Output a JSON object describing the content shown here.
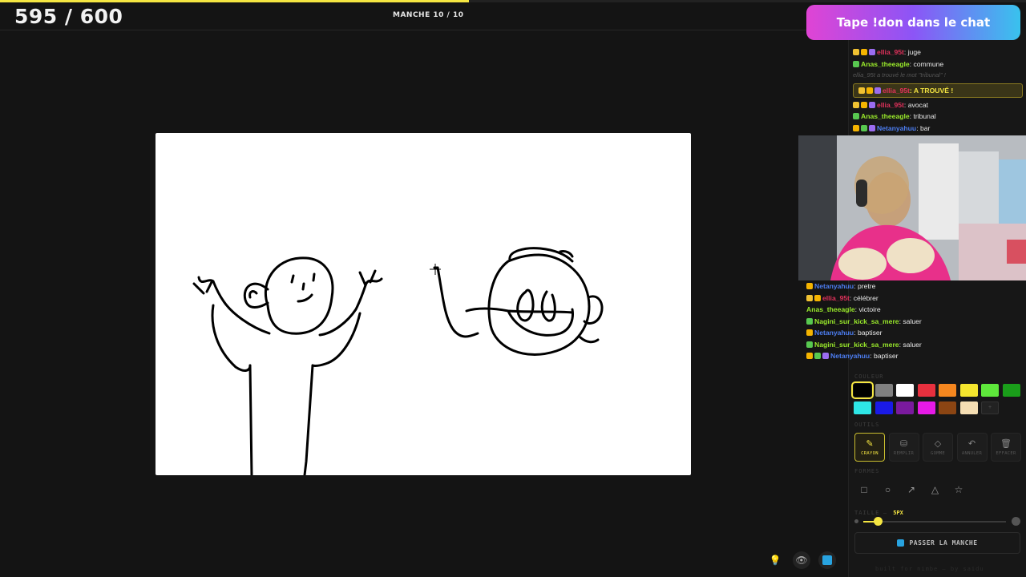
{
  "header": {
    "score": "595 / 600",
    "round": "MANCHE 10 / 10",
    "progress": 0.457
  },
  "banner": {
    "text": "Tape !don dans le chat"
  },
  "chat_top": [
    {
      "user": "ellia_95t",
      "msg": "juge",
      "color": "#e0315b",
      "badges": [
        "crown",
        "gold",
        "purple"
      ]
    },
    {
      "user": "Anas_theeagle",
      "msg": "commune",
      "color": "#9aea2b",
      "badges": [
        "green"
      ]
    },
    {
      "system": "ellia_95t a trouvé le mot \"tribunal\" !"
    },
    {
      "user": "ellia_95t",
      "msg": "A TROUVÉ !",
      "color": "#e0315b",
      "badges": [
        "crown",
        "gold",
        "purple"
      ],
      "found": true
    },
    {
      "user": "ellia_95t",
      "msg": "avocat",
      "color": "#e0315b",
      "badges": [
        "crown",
        "gold",
        "purple"
      ]
    },
    {
      "user": "Anas_theeagle",
      "msg": "tribunal",
      "color": "#9aea2b",
      "badges": [
        "green"
      ]
    },
    {
      "user": "Netanyahuu",
      "msg": "bar",
      "color": "#4c7df0",
      "badges": [
        "gold",
        "green",
        "purple"
      ]
    }
  ],
  "chat_bottom": [
    {
      "user": "Netanyahuu",
      "msg": "pretre",
      "color": "#4c7df0",
      "badges": [
        "gold"
      ]
    },
    {
      "user": "ellia_95t",
      "msg": "célébrer",
      "color": "#e0315b",
      "badges": [
        "crown",
        "gold"
      ]
    },
    {
      "user": "Anas_theeagle",
      "msg": "victoire",
      "color": "#9aea2b",
      "badges": []
    },
    {
      "user": "Nagini_sur_kick_sa_mere",
      "msg": "saluer",
      "color": "#9aea2b",
      "badges": [
        "green"
      ]
    },
    {
      "user": "Netanyahuu",
      "msg": "baptiser",
      "color": "#4c7df0",
      "badges": [
        "gold"
      ]
    },
    {
      "user": "Nagini_sur_kick_sa_mere",
      "msg": "saluer",
      "color": "#9aea2b",
      "badges": [
        "green"
      ]
    },
    {
      "user": "Netanyahuu",
      "msg": "baptiser",
      "color": "#4c7df0",
      "badges": [
        "gold",
        "green",
        "purple"
      ]
    }
  ],
  "sections": {
    "colors": "COULEUR",
    "tools": "OUTILS",
    "shapes": "FORMES",
    "size": "TAILLE"
  },
  "palette": [
    "#000000",
    "#808080",
    "#ffffff",
    "#e8303e",
    "#f5871f",
    "#f5e62e",
    "#5ee83b",
    "#1a9e1a",
    "#2ee6e6",
    "#1a1ae6",
    "#7a1a9e",
    "#e61ae6",
    "#8b4513",
    "#f5deb3"
  ],
  "tools": [
    {
      "label": "CRAYON",
      "icon": "pencil-icon",
      "glyph": "✎",
      "active": true
    },
    {
      "label": "REMPLIR",
      "icon": "bucket-icon",
      "glyph": "⛁",
      "active": false
    },
    {
      "label": "GOMME",
      "icon": "eraser-icon",
      "glyph": "◇",
      "active": false
    },
    {
      "label": "ANNULER",
      "icon": "undo-icon",
      "glyph": "↶",
      "active": false
    },
    {
      "label": "EFFACER",
      "icon": "trash-icon",
      "glyph": "🗑",
      "active": false
    }
  ],
  "shapes": [
    {
      "icon": "rectangle-icon",
      "glyph": "□"
    },
    {
      "icon": "ellipse-icon",
      "glyph": "○"
    },
    {
      "icon": "arrow-icon",
      "glyph": "↗"
    },
    {
      "icon": "triangle-icon",
      "glyph": "△"
    },
    {
      "icon": "star-icon",
      "glyph": "☆"
    }
  ],
  "size": {
    "value": "5PX",
    "level": 0.1
  },
  "skip_button": {
    "label": "PASSER LA MANCHE"
  },
  "footer": {
    "text": "built for nimbe — by saidu"
  }
}
